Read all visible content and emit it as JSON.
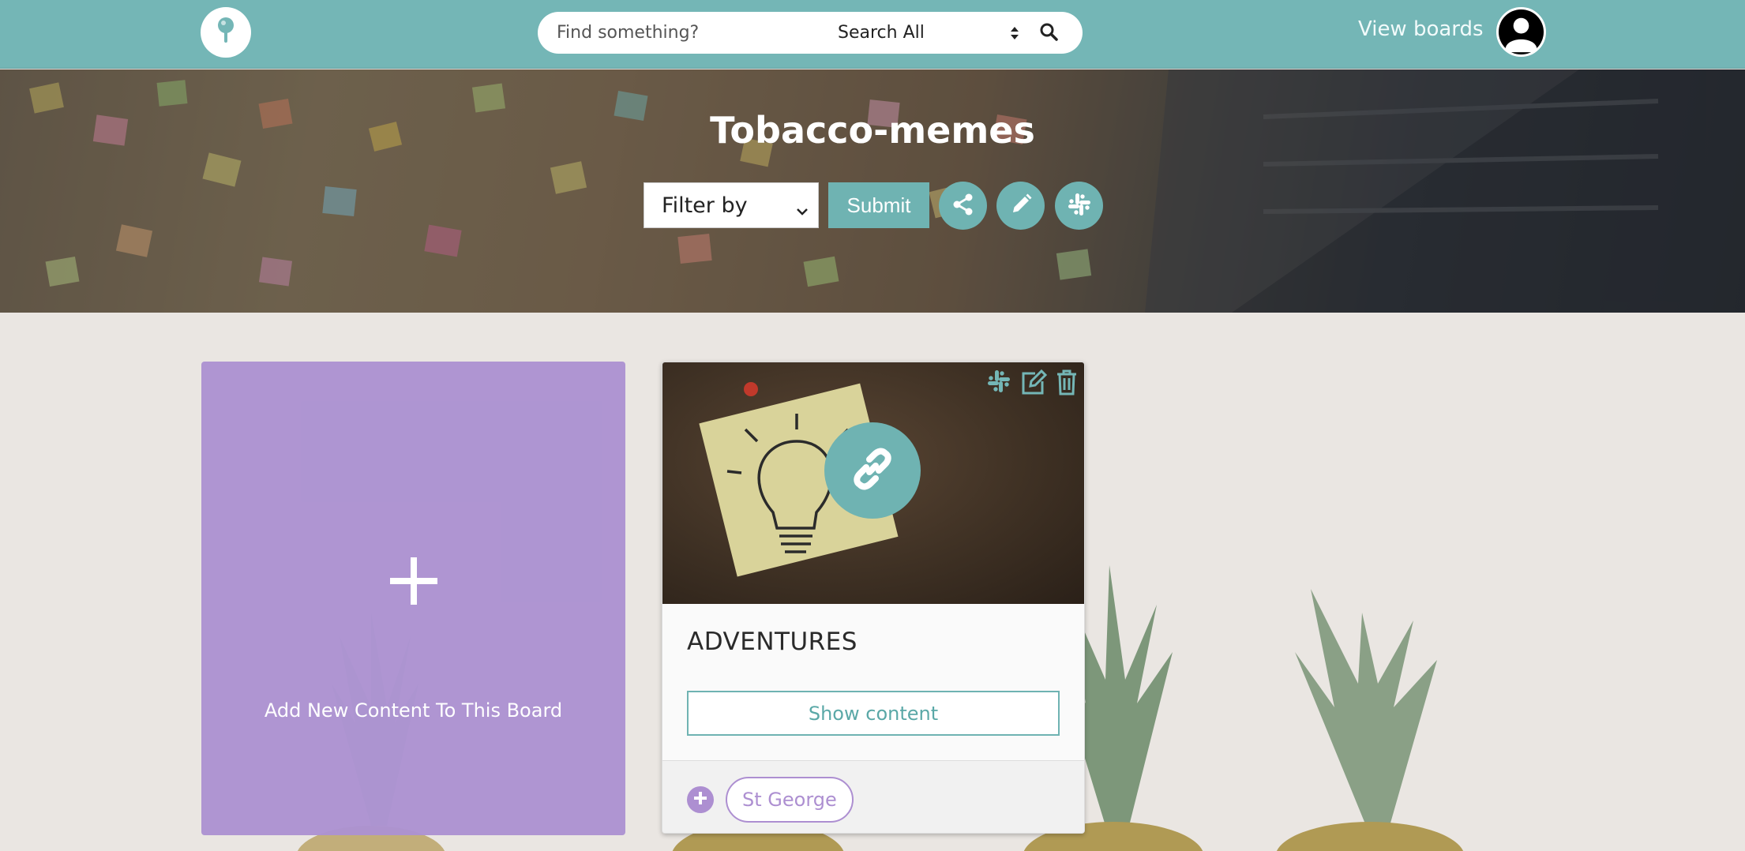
{
  "navbar": {
    "search": {
      "placeholder": "Find something?",
      "scope_selected": "Search All"
    },
    "view_boards_label": "View boards"
  },
  "board": {
    "title": "Tobacco-memes",
    "filter_selected": "Filter by",
    "submit_label": "Submit"
  },
  "add_card": {
    "label": "Add New Content To This Board"
  },
  "content_card": {
    "title": "ADVENTURES",
    "show_button_label": "Show content",
    "tags": [
      "St George"
    ]
  },
  "icons": {
    "logo": "pin-icon",
    "search": "search-icon",
    "share": "share-icon",
    "edit": "pencil-icon",
    "slack": "slack-icon",
    "delete": "trash-icon",
    "link": "link-icon",
    "add": "plus-icon",
    "avatar": "user-avatar-icon"
  },
  "colors": {
    "accent_teal": "#74b6b6",
    "purple": "#ad8fd1",
    "white": "#ffffff"
  }
}
